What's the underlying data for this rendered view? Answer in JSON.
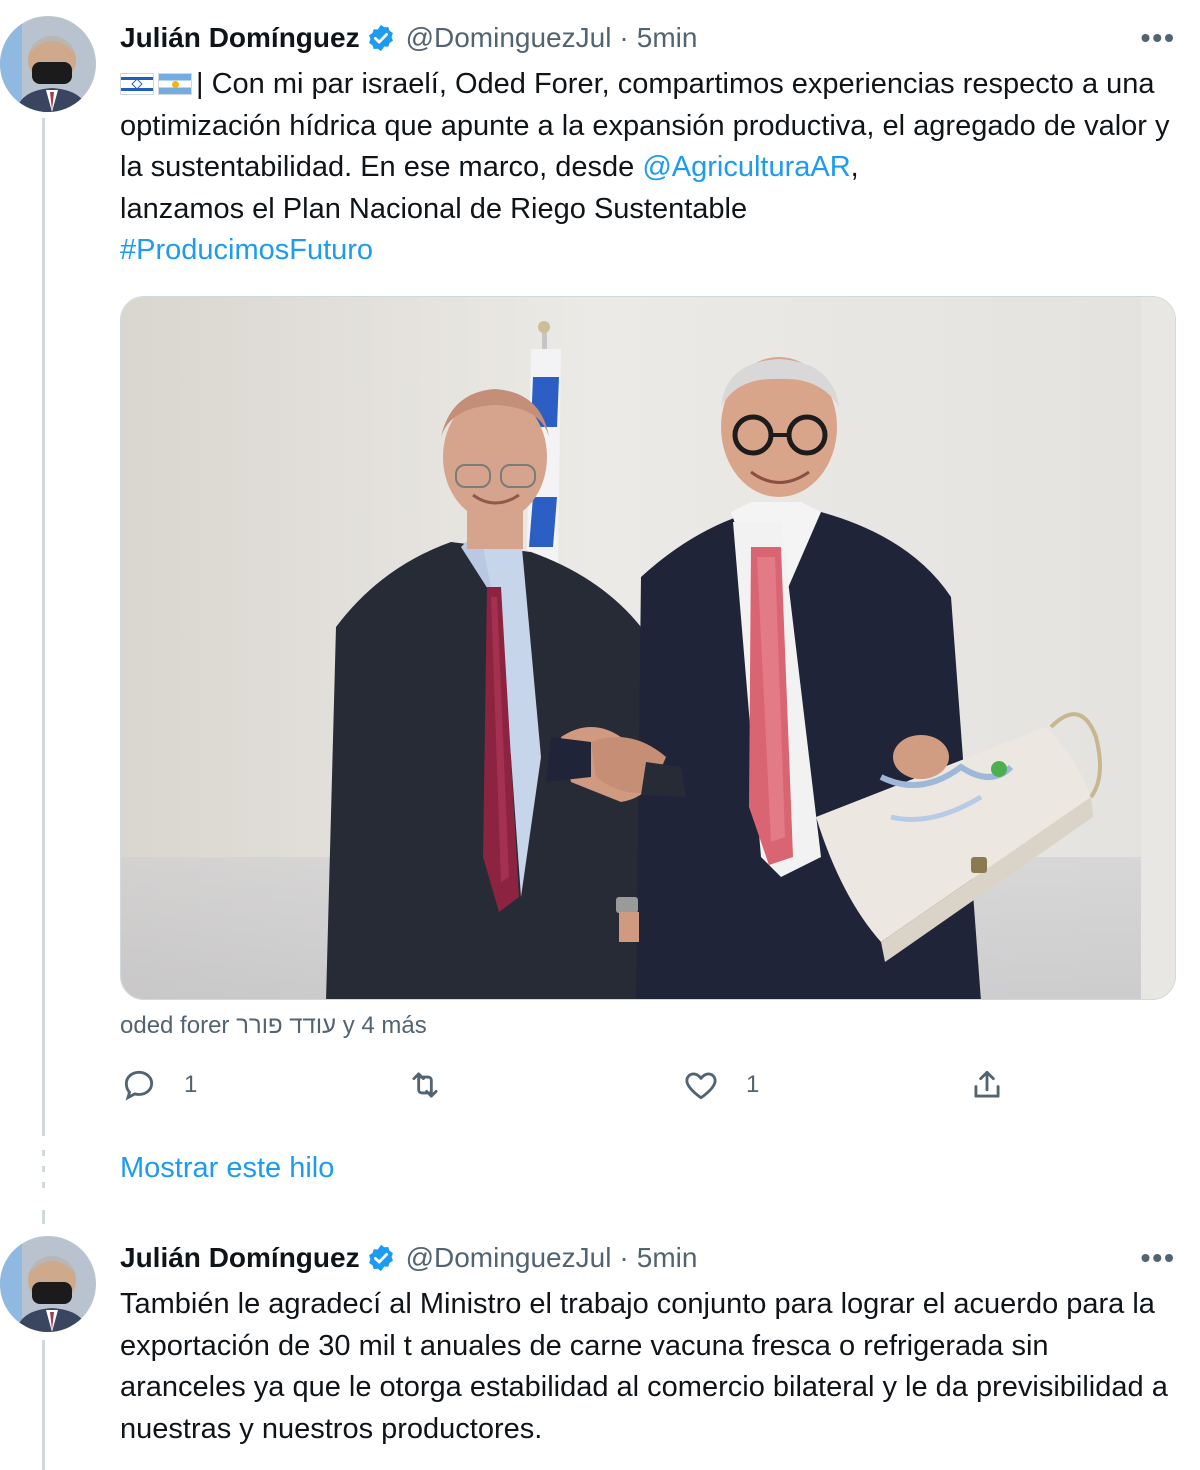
{
  "colors": {
    "accent": "#1d9bf0",
    "secondary_text": "#536471",
    "divider": "#cfd9de"
  },
  "tweet1": {
    "author_name": "Julián Domínguez",
    "handle": "@DominguezJul",
    "separator": "·",
    "time": "5min",
    "more_icon": "more-dots-icon",
    "flag1": "israel-flag",
    "flag2": "argentina-flag",
    "text_intro": "| Con mi par israelí, Oded Forer, compartimos experiencias respecto a una optimización hídrica que apunte a la expansión productiva, el agregado de valor y la sustentabilidad. En ese marco, desde ",
    "mention": "@AgriculturaAR",
    "text_after_mention": ",",
    "text_line4": "lanzamos el Plan Nacional de Riego Sustentable",
    "hashtag": "#ProducimosFuturo",
    "tagged": "oded forer עודד פורר y 4 más",
    "reply_count": "1",
    "retweet_count": "",
    "like_count": "1"
  },
  "show_thread": "Mostrar este hilo",
  "tweet2": {
    "author_name": "Julián Domínguez",
    "handle": "@DominguezJul",
    "separator": "·",
    "time": "5min",
    "text": "También le agradecí al Ministro el trabajo conjunto para lograr el acuerdo para la exportación de 30 mil t anuales de carne vacuna fresca o refrigerada sin aranceles ya que le otorga estabilidad al comercio bilateral y le da previsibilidad a nuestras y nuestros productores."
  }
}
